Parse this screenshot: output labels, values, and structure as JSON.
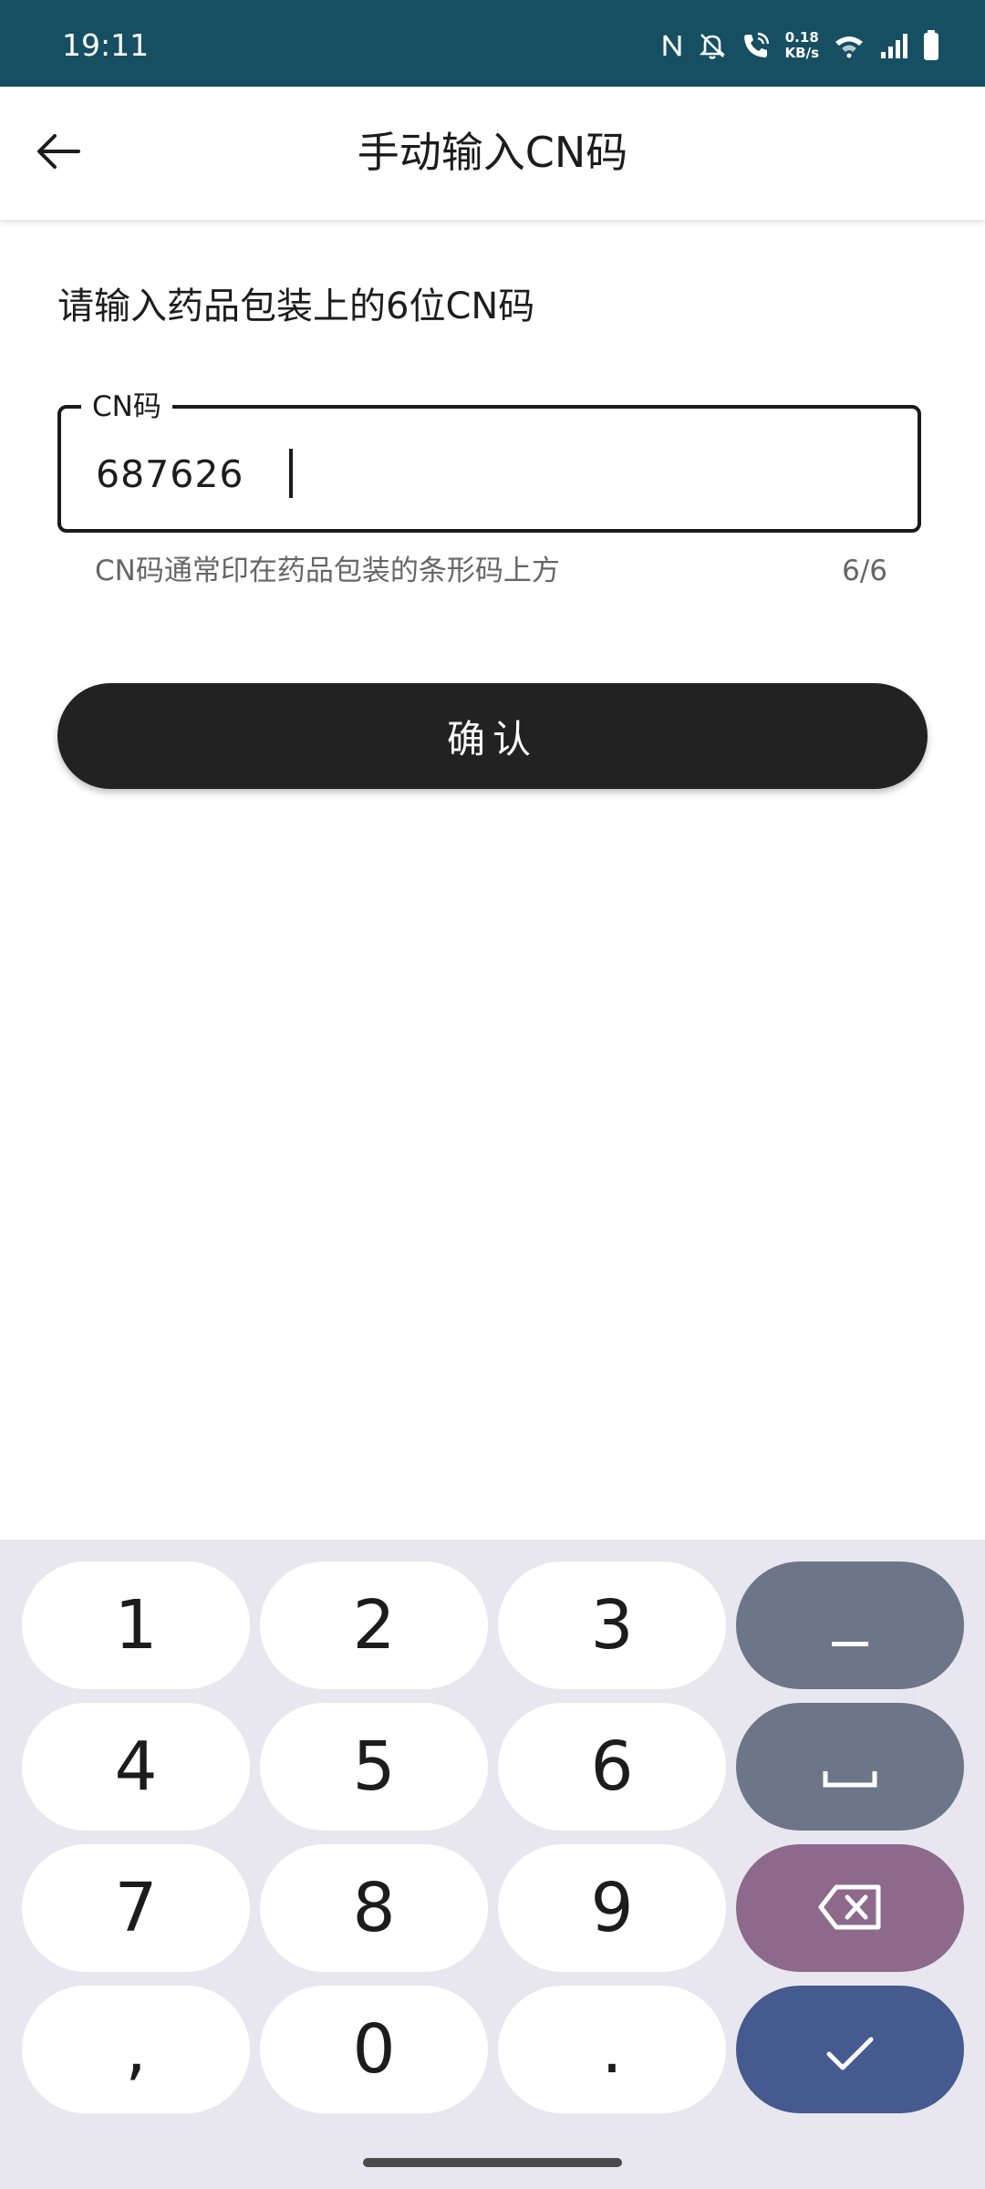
{
  "status_bar": {
    "time": "19:11",
    "net_speed_value": "0.18",
    "net_speed_unit": "KB/s",
    "icons": [
      "nfc-icon",
      "bell-off-icon",
      "phone-wifi-call-icon",
      "wifi-icon",
      "signal-icon",
      "battery-icon"
    ]
  },
  "app_bar": {
    "title": "手动输入CN码",
    "back_icon": "arrow-left-icon"
  },
  "form": {
    "instruction": "请输入药品包装上的6位CN码",
    "field_label": "CN码",
    "field_value": "687626",
    "helper_text": "CN码通常印在药品包装的条形码上方",
    "counter": "6/6",
    "confirm_label": "确认"
  },
  "keyboard": {
    "keys": {
      "k1": "1",
      "k2": "2",
      "k3": "3",
      "k4": "4",
      "k5": "5",
      "k6": "6",
      "k7": "7",
      "k8": "8",
      "k9": "9",
      "comma": ",",
      "k0": "0",
      "period": "."
    },
    "function_keys": [
      "minus-icon",
      "space-icon",
      "backspace-icon",
      "check-icon"
    ],
    "colors": {
      "gray": "#6d7588",
      "purple": "#8d6a8b",
      "blue": "#455a8f",
      "background": "#e8e7ef"
    }
  },
  "colors": {
    "status_bar": "#174f62",
    "button": "#222222"
  }
}
